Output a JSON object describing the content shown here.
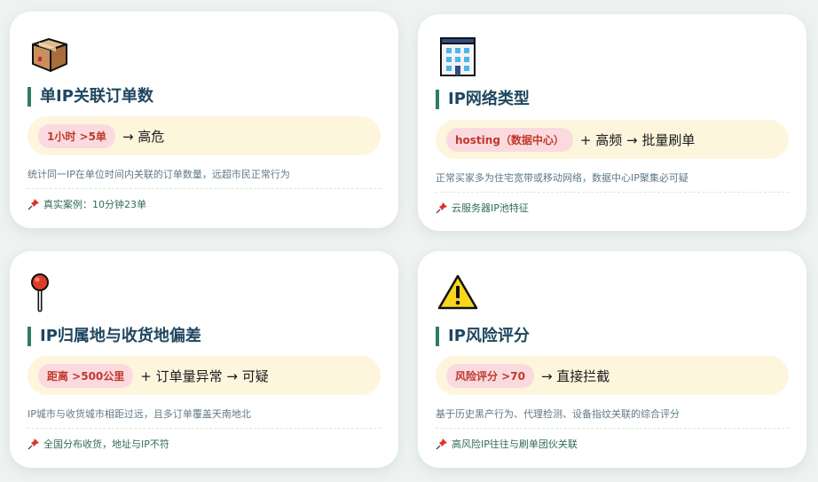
{
  "cards": [
    {
      "icon": "package-box-icon",
      "title": "单IP关联订单数",
      "pill": "1小时 >5单",
      "rest": "→ 高危",
      "description": "统计同一IP在单位时间内关联的订单数量，远超市民正常行为",
      "case": "真实案例：10分钟23单"
    },
    {
      "icon": "office-building-icon",
      "title": "IP网络类型",
      "pill": "hosting（数据中心）",
      "rest": "+ 高频 → 批量刷单",
      "description": "正常买家多为住宅宽带或移动网络，数据中心IP聚集必可疑",
      "case": "云服务器IP池特征"
    },
    {
      "icon": "round-pushpin-icon",
      "title": "IP归属地与收货地偏差",
      "pill": "距离 >500公里",
      "rest": "+ 订单量异常 → 可疑",
      "description": "IP城市与收货城市相距过远，且多订单覆盖天南地北",
      "case": "全国分布收货，地址与IP不符"
    },
    {
      "icon": "warning-sign-icon",
      "title": "IP风险评分",
      "pill": "风险评分 >70",
      "rest": "→ 直接拦截",
      "description": "基于历史黑产行为、代理检测、设备指纹关联的综合评分",
      "case": "高风险IP往往与刷单团伙关联"
    }
  ],
  "colors": {
    "accent_bar": "#2f7d5f",
    "title": "#1f4660",
    "pill_bg": "#fadadf",
    "pill_text": "#c0392b",
    "formula_bg": "#fdf6dd",
    "case_text": "#2f6d50",
    "pin_icon": "pushpin-icon"
  }
}
